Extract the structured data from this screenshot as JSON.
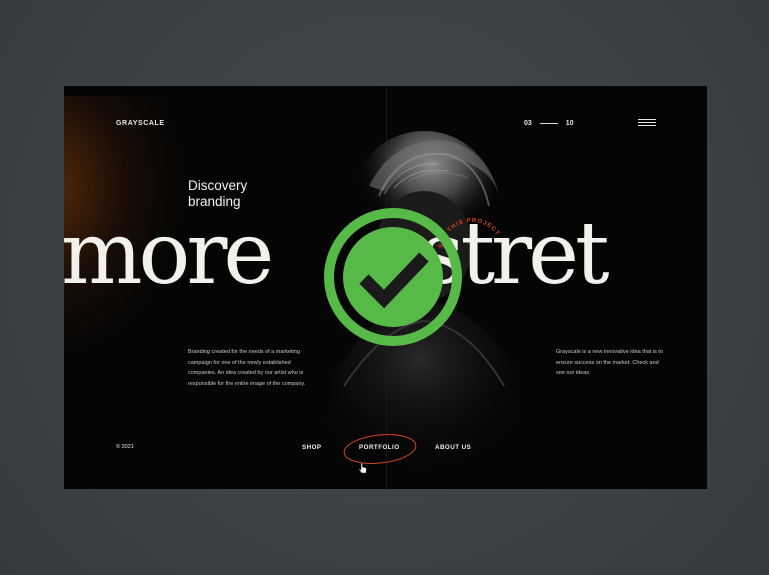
{
  "header": {
    "brand": "GRAYSCALE",
    "counter_current": "03",
    "counter_total": "10",
    "menu_icon": "hamburger-menu-icon"
  },
  "hero": {
    "tagline_line1": "Discovery",
    "tagline_line2": "branding",
    "headline_left": "more",
    "headline_right": "stret",
    "circular_text": "SEE THIS PROJECT"
  },
  "descriptions": {
    "left": "Branding created for the needs of a marketing campaign for one of the newly established companies. An idea created by our artist who is responsible for the entire image of the company.",
    "right": "Grayscale is a new innovative idea that is to ensure success on the market. Check and see our ideas."
  },
  "footer": {
    "copyright": "© 2021",
    "nav": [
      "SHOP",
      "PORTFOLIO",
      "ABOUT US"
    ]
  },
  "overlay": {
    "icon": "green-checkmark-badge-icon",
    "color": "#57b947"
  },
  "colors": {
    "background": "#050505",
    "outer": "#3f4346",
    "accent_orange": "#d2451d",
    "text": "#f3f1ec"
  }
}
